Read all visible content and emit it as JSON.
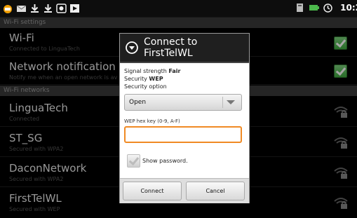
{
  "status_bar": {
    "time": "10:2",
    "left_icons": [
      "usb-debug-icon",
      "email-icon",
      "download-icon",
      "download-icon",
      "android-icon",
      "media-icon"
    ],
    "right_icons": [
      "signal-icon",
      "battery-icon",
      "alarm-icon"
    ]
  },
  "sections": {
    "wifi_settings_header": "Wi-Fi settings",
    "wifi_networks_header": "Wi-Fi networks"
  },
  "settings": [
    {
      "title": "Wi-Fi",
      "summary": "Connected to LinguaTech",
      "checked": true
    },
    {
      "title": "Network notification",
      "summary": "Notify me when an open network is av",
      "checked": true
    }
  ],
  "networks": [
    {
      "title": "LinguaTech",
      "summary": "Connected"
    },
    {
      "title": "ST_SG",
      "summary": "Secured with WPA2"
    },
    {
      "title": "DaconNetwork",
      "summary": "Secured with WPA2"
    },
    {
      "title": "FirstTelWL",
      "summary": "Secured with WEP"
    }
  ],
  "dialog": {
    "title": "Connect to FirstTelWL",
    "signal_label": "Signal strength",
    "signal_value": "Fair",
    "security_label": "Security",
    "security_value": "WEP",
    "security_option_label": "Security option",
    "security_option_value": "Open",
    "wep_label": "WEP hex key (0-9, A-F)",
    "wep_value": "",
    "show_password_label": "Show password.",
    "connect_label": "Connect",
    "cancel_label": "Cancel"
  },
  "colors": {
    "focus_orange": "#f08a24",
    "check_green": "#4cb84c",
    "section_bg": "#3a3a3a"
  }
}
